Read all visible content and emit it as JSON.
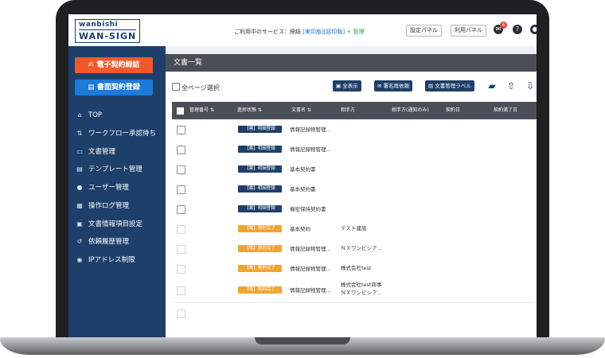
{
  "header": {
    "logo_top": "wanbishi",
    "logo_bottom": "WAN-SIGN",
    "service_prefix": "ご利用中のサービス：",
    "service_main": "締結",
    "service_opt1": "[実印版]",
    "service_opt2": "[認印版]",
    "service_plus": "+ 管理",
    "settings_panel": "設定パネル",
    "usage_panel": "利用パネル",
    "notification_count": "6",
    "help": "?"
  },
  "sidebar": {
    "contract_button": "電子契約締結",
    "paper_button": "書面契約登録",
    "items": [
      {
        "icon": "home-icon",
        "glyph": "⌂",
        "label": "TOP"
      },
      {
        "icon": "workflow-icon",
        "glyph": "⇅",
        "label": "ワークフロー承認待ち"
      },
      {
        "icon": "inbox-icon",
        "glyph": "▭",
        "label": "文書管理"
      },
      {
        "icon": "template-icon",
        "glyph": "▤",
        "label": "テンプレート管理"
      },
      {
        "icon": "user-icon",
        "glyph": "●",
        "label": "ユーザー管理"
      },
      {
        "icon": "log-icon",
        "glyph": "▦",
        "label": "操作ログ管理"
      },
      {
        "icon": "doc-info-icon",
        "glyph": "▣",
        "label": "文書情報項目設定"
      },
      {
        "icon": "history-icon",
        "glyph": "↺",
        "label": "依頼履歴管理"
      },
      {
        "icon": "location-icon",
        "glyph": "◉",
        "label": "IPアドレス制限"
      }
    ]
  },
  "main": {
    "title": "文書一覧",
    "select_all": "全ページ選択",
    "actions": {
      "show_all": "全表示",
      "resend": "署名再依頼",
      "label": "文書管理ラベル"
    },
    "columns": [
      "管理番号",
      "進捗状態",
      "文書名",
      "相手方",
      "相手方(通知のみ)",
      "契約日",
      "契約満了日"
    ],
    "rows": [
      {
        "status": "【書】明細登録",
        "status_type": "blue",
        "doc": "情報記録物管理...",
        "partner": ""
      },
      {
        "status": "【書】明細登録",
        "status_type": "blue",
        "doc": "情報記録物管理...",
        "partner": ""
      },
      {
        "status": "【書】明細登録",
        "status_type": "blue",
        "doc": "基本契約書",
        "partner": ""
      },
      {
        "status": "【書】明細登録",
        "status_type": "blue",
        "doc": "基本契約書",
        "partner": ""
      },
      {
        "status": "【書】明細登録",
        "status_type": "blue",
        "doc": "機密保持契約書",
        "partner": ""
      },
      {
        "status": "【電】契約完了",
        "status_type": "orange",
        "doc": "基本契約",
        "partner": "テスト建設"
      },
      {
        "status": "【電】契約完了",
        "status_type": "orange",
        "doc": "情報記録物管理...",
        "partner": "ＮＸワンビシア..."
      },
      {
        "status": "【電】契約完了",
        "status_type": "orange",
        "doc": "情報記録物管理...",
        "partner": "株式会社test"
      },
      {
        "status": "【電】契約完了",
        "status_type": "orange",
        "doc": "情報記録物管理...",
        "partner": "株式会社test商事",
        "partner2": "ＮＸワンビシア..."
      }
    ]
  },
  "colors": {
    "navy": "#1f3f6b",
    "orange": "#f2592a",
    "blue": "#1c7ad8",
    "status_orange": "#f0a531"
  }
}
